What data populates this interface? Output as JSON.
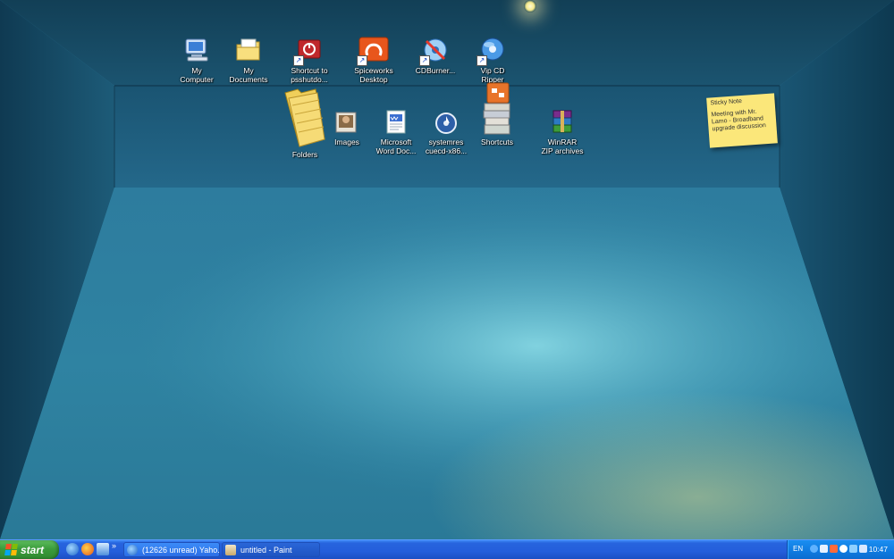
{
  "desktop": {
    "icons_top": [
      {
        "label": "My\nComputer"
      },
      {
        "label": "My\nDocuments"
      },
      {
        "label": "Shortcut to\npsshutdo..."
      },
      {
        "label": "Spiceworks\nDesktop"
      },
      {
        "label": "CDBurner..."
      },
      {
        "label": "Vip CD\nRipper"
      }
    ],
    "icons_shelf": [
      {
        "label": "Folders"
      },
      {
        "label": "Images"
      },
      {
        "label": "Microsoft\nWord Doc..."
      },
      {
        "label": "systemres\ncuecd-x86..."
      },
      {
        "label": "Shortcuts"
      },
      {
        "label": "WinRAR\nZIP archives"
      }
    ],
    "sticky_note": {
      "title": "Sticky Note",
      "body": "Meeting with Mr. Lamo - Broadband upgrade discussion"
    }
  },
  "taskbar": {
    "start_label": "start",
    "quick_launch": [
      "internet-explorer-icon",
      "firefox-icon",
      "show-desktop-icon"
    ],
    "overflow_label": "»",
    "tasks": [
      {
        "label": "(12626 unread) Yaho...",
        "icon": "internet-explorer-icon"
      },
      {
        "label": "untitled - Paint",
        "icon": "paint-icon"
      }
    ],
    "tray": {
      "language": "EN",
      "clock": "10:47"
    }
  },
  "colors": {
    "taskbar_blue": "#245edb",
    "start_green": "#3c9c3c",
    "tray_blue": "#0f7ae0",
    "sticky_yellow": "#fbe77a"
  }
}
